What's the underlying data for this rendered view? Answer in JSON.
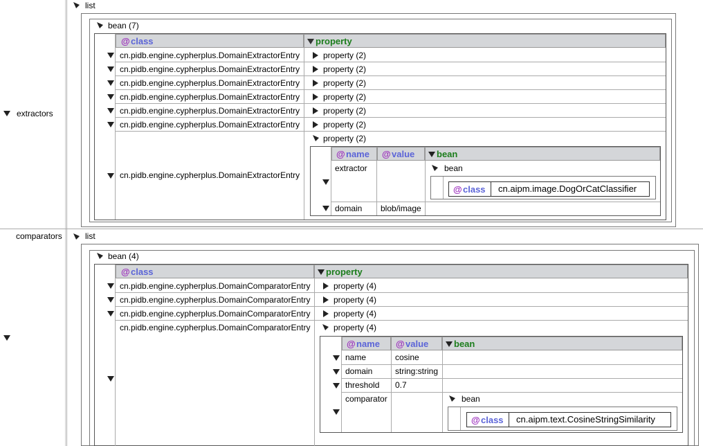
{
  "extractors": {
    "key": "extractors",
    "list_label": "list",
    "bean_label": "bean (7)",
    "class_header": "class",
    "property_header": "property",
    "rows": [
      {
        "class": "cn.pidb.engine.cypherplus.DomainExtractorEntry",
        "property": "property (2)"
      },
      {
        "class": "cn.pidb.engine.cypherplus.DomainExtractorEntry",
        "property": "property (2)"
      },
      {
        "class": "cn.pidb.engine.cypherplus.DomainExtractorEntry",
        "property": "property (2)"
      },
      {
        "class": "cn.pidb.engine.cypherplus.DomainExtractorEntry",
        "property": "property (2)"
      },
      {
        "class": "cn.pidb.engine.cypherplus.DomainExtractorEntry",
        "property": "property (2)"
      },
      {
        "class": "cn.pidb.engine.cypherplus.DomainExtractorEntry",
        "property": "property (2)"
      },
      {
        "class": "cn.pidb.engine.cypherplus.DomainExtractorEntry",
        "property": "property (2)"
      }
    ],
    "expanded": {
      "name_header": "name",
      "value_header": "value",
      "bean_header": "bean",
      "props": [
        {
          "name": "extractor",
          "value": "",
          "bean_label": "bean",
          "class_key": "class",
          "class_value": "cn.aipm.image.DogOrCatClassifier"
        },
        {
          "name": "domain",
          "value": "blob/image"
        }
      ]
    }
  },
  "comparators": {
    "key": "comparators",
    "list_label": "list",
    "bean_label": "bean (4)",
    "class_header": "class",
    "property_header": "property",
    "rows": [
      {
        "class": "cn.pidb.engine.cypherplus.DomainComparatorEntry",
        "property": "property (4)"
      },
      {
        "class": "cn.pidb.engine.cypherplus.DomainComparatorEntry",
        "property": "property (4)"
      },
      {
        "class": "cn.pidb.engine.cypherplus.DomainComparatorEntry",
        "property": "property (4)"
      },
      {
        "class": "cn.pidb.engine.cypherplus.DomainComparatorEntry",
        "property": "property (4)"
      }
    ],
    "expanded": {
      "name_header": "name",
      "value_header": "value",
      "bean_header": "bean",
      "props": [
        {
          "name": "name",
          "value": "cosine"
        },
        {
          "name": "domain",
          "value": "string:string"
        },
        {
          "name": "threshold",
          "value": "0.7"
        },
        {
          "name": "comparator",
          "value": "",
          "bean_label": "bean",
          "class_key": "class",
          "class_value": "cn.aipm.text.CosineStringSimilarity"
        }
      ]
    }
  },
  "at_symbol": "@",
  "colors": {
    "header_bg": "#d4d6d9",
    "attr": "#5b64d8",
    "at": "#9c2fbd",
    "elem": "#1c7d1c"
  }
}
